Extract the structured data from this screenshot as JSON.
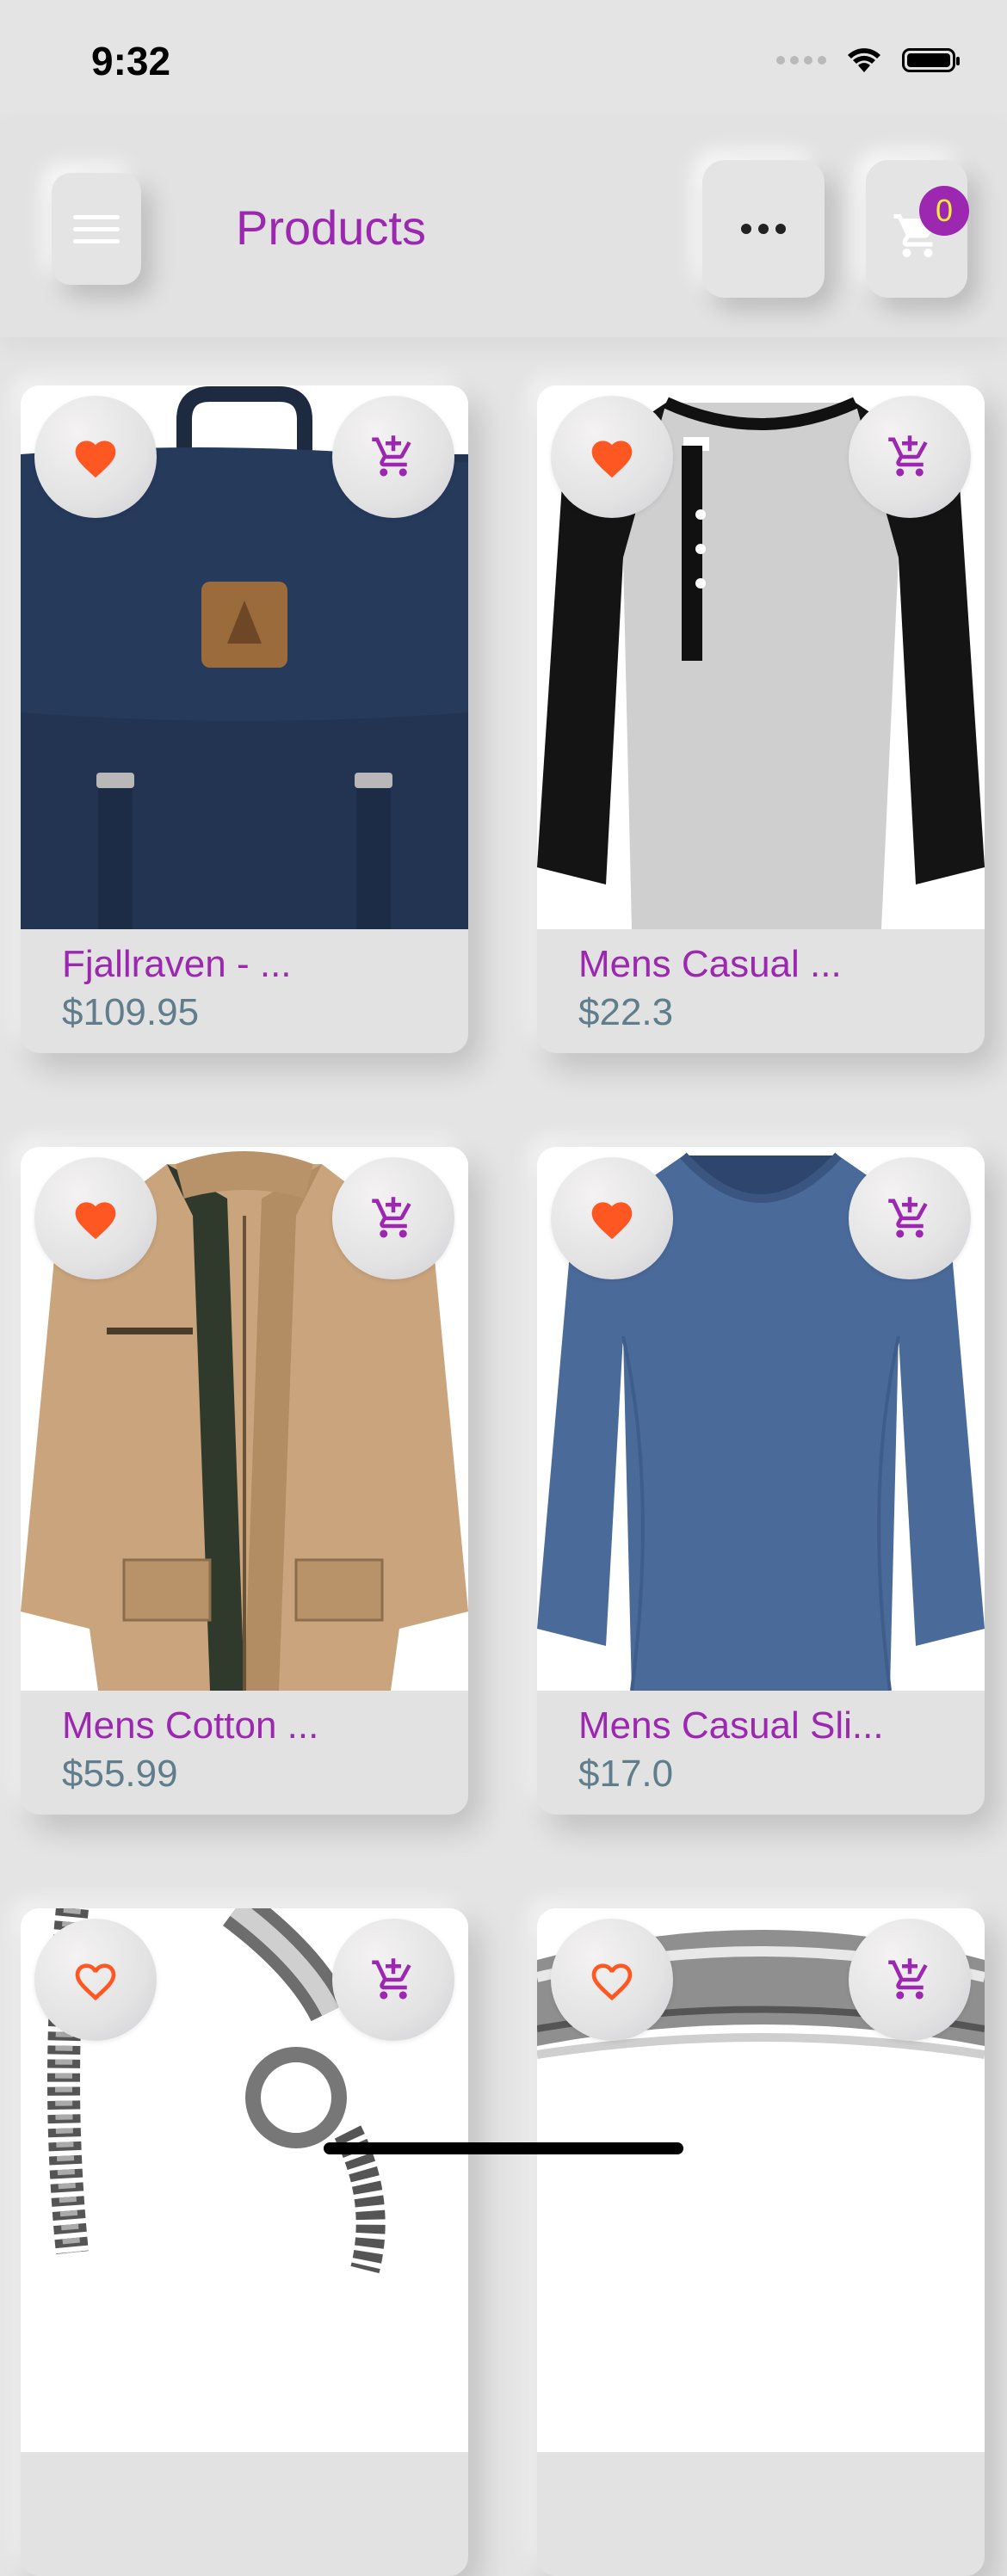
{
  "status_bar": {
    "time": "9:32"
  },
  "header": {
    "title": "Products",
    "cart_count": "0"
  },
  "colors": {
    "accent": "#9c27b0",
    "heart": "#ff5722",
    "price": "#607d8b",
    "badge_text": "#ffeb3b"
  },
  "products": [
    {
      "name": "Fjallraven - ...",
      "price": "$109.95",
      "favorite": true,
      "image": "navy-backpack"
    },
    {
      "name": "Mens Casual ...",
      "price": "$22.3",
      "favorite": true,
      "image": "raglan-henley-shirt"
    },
    {
      "name": "Mens Cotton ...",
      "price": "$55.99",
      "favorite": true,
      "image": "khaki-jacket"
    },
    {
      "name": "Mens Casual Sli...",
      "price": "$17.0",
      "favorite": true,
      "image": "blue-long-sleeve-tee"
    },
    {
      "name": "",
      "price": "",
      "favorite": false,
      "image": "silver-dragon-bracelet"
    },
    {
      "name": "",
      "price": "",
      "favorite": false,
      "image": "silver-ring"
    }
  ],
  "icons": {
    "menu": "menu-icon",
    "more": "more-horizontal-icon",
    "cart": "shopping-cart-icon",
    "favorite": "heart-icon",
    "add_to_cart": "add-shopping-cart-icon"
  }
}
